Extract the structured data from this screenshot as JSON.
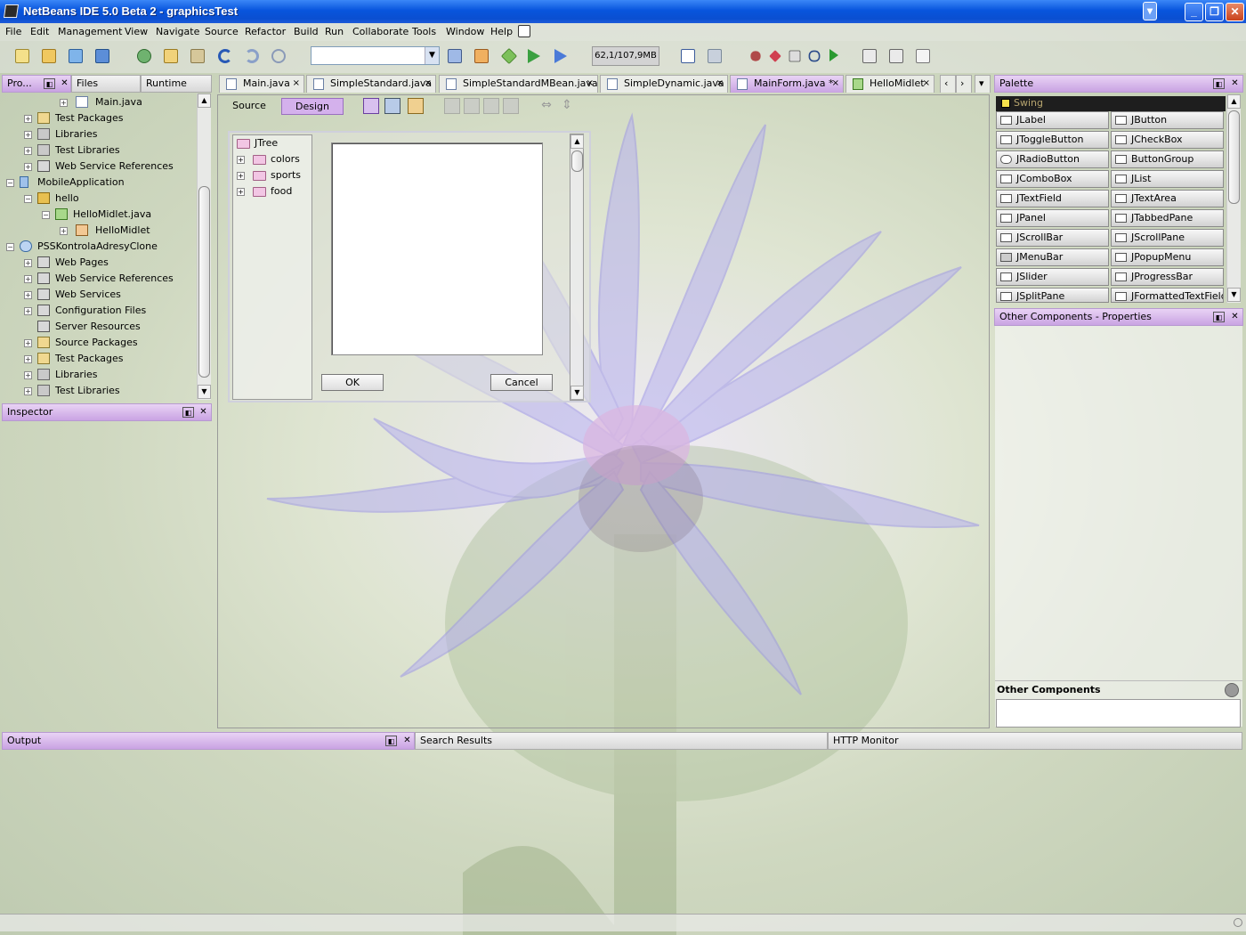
{
  "window": {
    "title": "NetBeans IDE 5.0 Beta 2 - graphicsTest"
  },
  "menu": [
    "File",
    "Edit",
    "Management",
    "View",
    "Navigate",
    "Source",
    "Refactor",
    "Build",
    "Run",
    "Collaborate",
    "Tools",
    "Window",
    "Help"
  ],
  "toolbar": {
    "memory": "62,1/107,9MB",
    "config_value": ""
  },
  "projects_tabs": [
    "Pro...",
    "Files",
    "Runtime"
  ],
  "tree": [
    {
      "label": "Main.java",
      "icon": "java-file-icon"
    },
    {
      "label": "Test Packages",
      "icon": "package-folder-icon"
    },
    {
      "label": "Libraries",
      "icon": "library-icon"
    },
    {
      "label": "Test Libraries",
      "icon": "library-icon"
    },
    {
      "label": "Web Service References",
      "icon": "webservice-icon"
    },
    {
      "label": "MobileApplication",
      "icon": "mobile-project-icon"
    },
    {
      "label": "hello",
      "icon": "package-icon"
    },
    {
      "label": "HelloMidlet.java",
      "icon": "midlet-icon"
    },
    {
      "label": "HelloMidlet",
      "icon": "class-icon"
    },
    {
      "label": "PSSKontrolaAdresyClone",
      "icon": "web-project-icon"
    },
    {
      "label": "Web Pages",
      "icon": "folder-icon"
    },
    {
      "label": "Web Service References",
      "icon": "webservice-icon"
    },
    {
      "label": "Web Services",
      "icon": "webservice-icon"
    },
    {
      "label": "Configuration Files",
      "icon": "folder-icon"
    },
    {
      "label": "Server Resources",
      "icon": "folder-icon"
    },
    {
      "label": "Source Packages",
      "icon": "package-folder-icon"
    },
    {
      "label": "Test Packages",
      "icon": "package-folder-icon"
    },
    {
      "label": "Libraries",
      "icon": "library-icon"
    },
    {
      "label": "Test Libraries",
      "icon": "library-icon"
    }
  ],
  "inspector": {
    "title": "Inspector"
  },
  "editor_tabs": [
    {
      "label": "Main.java"
    },
    {
      "label": "SimpleStandard.java"
    },
    {
      "label": "SimpleStandardMBean.java"
    },
    {
      "label": "SimpleDynamic.java"
    },
    {
      "label": "MainForm.java *"
    },
    {
      "label": "HelloMidlet"
    }
  ],
  "editor": {
    "source_label": "Source",
    "design_label": "Design"
  },
  "form": {
    "jtree_root": "JTree",
    "jtree_children": [
      "colors",
      "sports",
      "food"
    ],
    "ok_label": "OK",
    "cancel_label": "Cancel"
  },
  "palette": {
    "title": "Palette",
    "category": "Swing",
    "items": [
      "JLabel",
      "JButton",
      "JToggleButton",
      "JCheckBox",
      "JRadioButton",
      "ButtonGroup",
      "JComboBox",
      "JList",
      "JTextField",
      "JTextArea",
      "JPanel",
      "JTabbedPane",
      "JScrollBar",
      "JScrollPane",
      "JMenuBar",
      "JPopupMenu",
      "JSlider",
      "JProgressBar",
      "JSplitPane",
      "JFormattedTextField"
    ]
  },
  "properties": {
    "title": "Other Components - Properties",
    "section": "Other Components"
  },
  "bottom": {
    "output": "Output",
    "search": "Search Results",
    "http": "HTTP Monitor"
  },
  "colors": {
    "accent": "#c9a3e3",
    "titlebar": "#0a4fd1"
  }
}
